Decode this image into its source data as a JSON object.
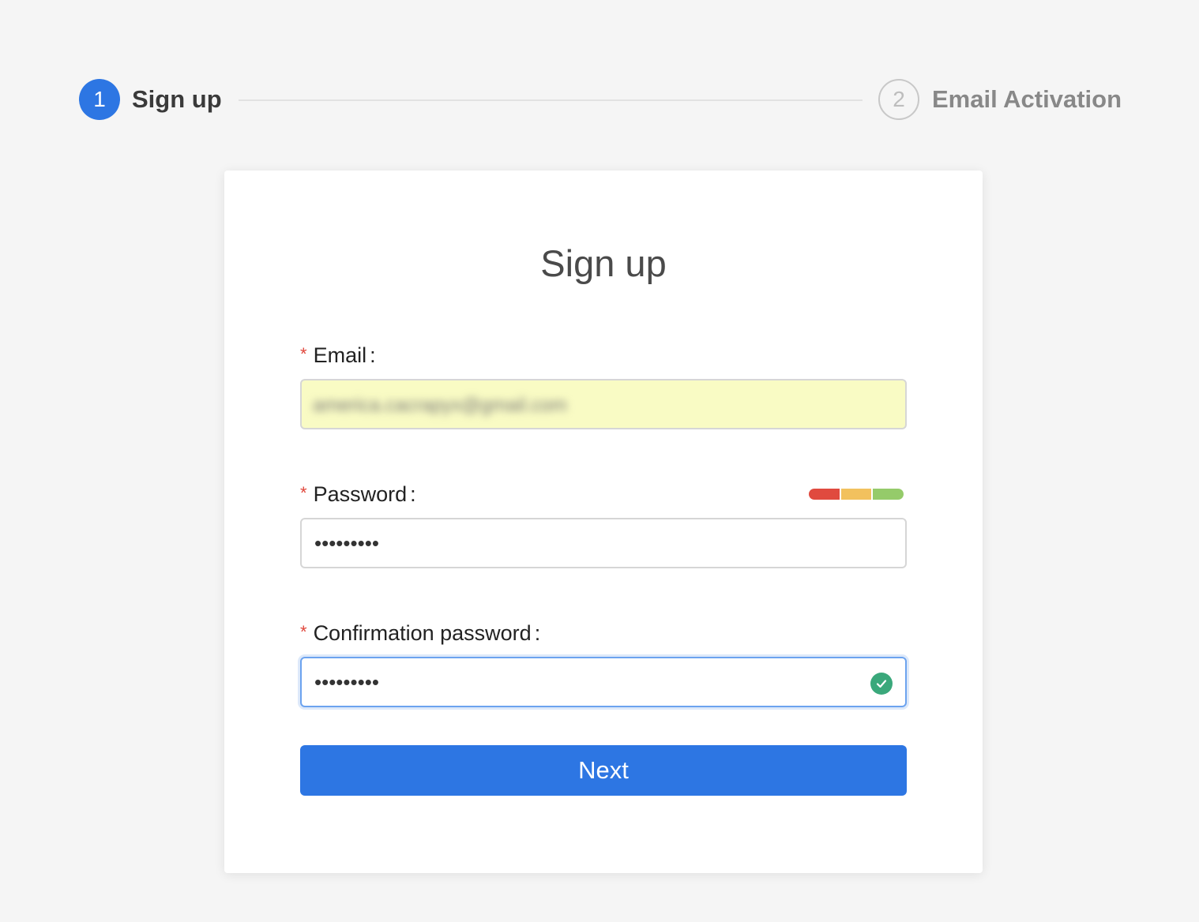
{
  "stepper": {
    "steps": [
      {
        "number": "1",
        "label": "Sign up",
        "state": "active"
      },
      {
        "number": "2",
        "label": "Email Activation",
        "state": "pending"
      }
    ]
  },
  "form": {
    "title": "Sign up",
    "required_mark": "*",
    "email": {
      "label": "Email",
      "value": "america.cacrapyx@gmail.com",
      "blurred": true
    },
    "password": {
      "label": "Password",
      "masked_value": "•••••••••",
      "strength_colors": [
        "#e04a3f",
        "#f2c15e",
        "#95cb6a"
      ]
    },
    "confirm_password": {
      "label": "Confirmation password",
      "masked_value": "•••••••••",
      "status_icon": "check-circle-icon",
      "status_color": "#3aa87b"
    },
    "submit_label": "Next"
  },
  "colors": {
    "accent": "#2d76e3",
    "required": "#e0473c",
    "autofill_bg": "#f9fbc4"
  }
}
